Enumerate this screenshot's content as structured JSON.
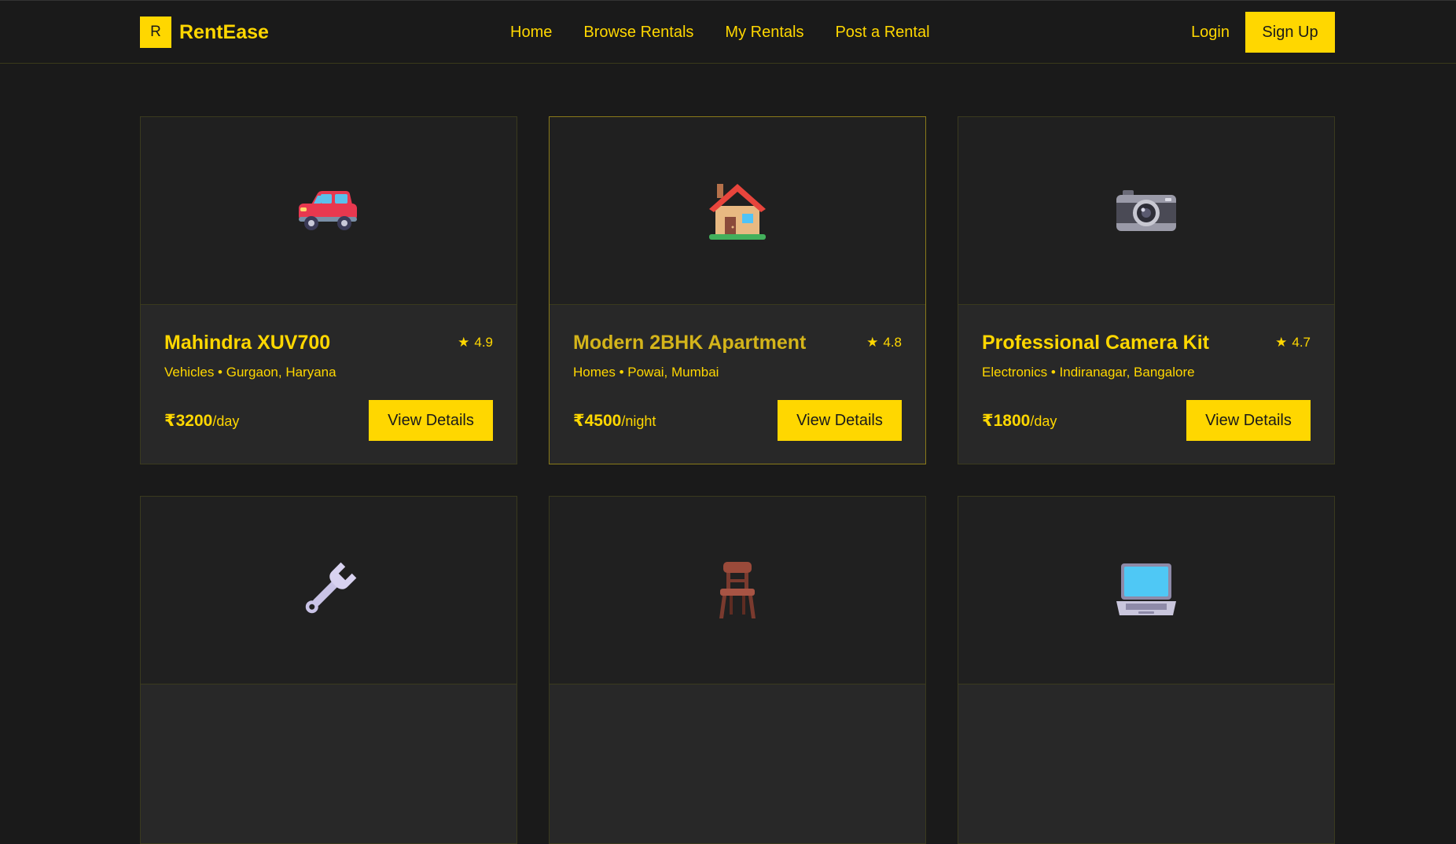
{
  "brand": {
    "mark": "R",
    "name": "RentEase"
  },
  "nav": {
    "links": [
      "Home",
      "Browse Rentals",
      "My Rentals",
      "Post a Rental"
    ],
    "login": "Login",
    "signup": "Sign Up"
  },
  "colors": {
    "accent": "#ffd700",
    "background": "#1a1a1a",
    "card": "#232323"
  },
  "listings": [
    {
      "icon": "car-icon",
      "title": "Mahindra XUV700",
      "rating": "4.9",
      "category": "Vehicles",
      "location": "Gurgaon, Haryana",
      "meta": "Vehicles • Gurgaon, Haryana",
      "price": "₹3200",
      "unit": "/day",
      "button": "View Details"
    },
    {
      "icon": "house-icon",
      "title": "Modern 2BHK Apartment",
      "rating": "4.8",
      "category": "Homes",
      "location": "Powai, Mumbai",
      "meta": "Homes • Powai, Mumbai",
      "price": "₹4500",
      "unit": "/night",
      "button": "View Details"
    },
    {
      "icon": "camera-icon",
      "title": "Professional Camera Kit",
      "rating": "4.7",
      "category": "Electronics",
      "location": "Indiranagar, Bangalore",
      "meta": "Electronics • Indiranagar, Bangalore",
      "price": "₹1800",
      "unit": "/day",
      "button": "View Details"
    },
    {
      "icon": "wrench-icon"
    },
    {
      "icon": "chair-icon"
    },
    {
      "icon": "laptop-icon"
    }
  ],
  "star_glyph": "★"
}
